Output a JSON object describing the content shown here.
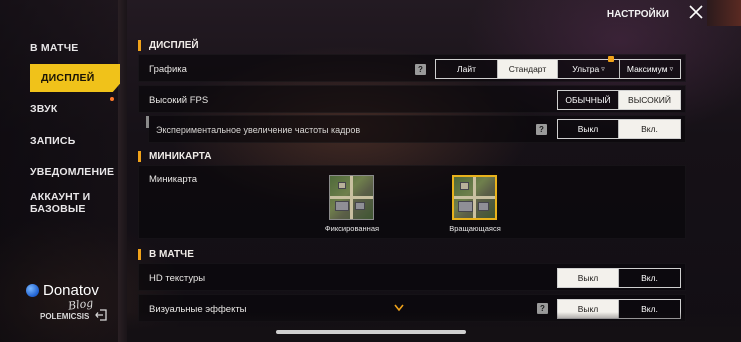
{
  "header": {
    "title": "НАСТРОЙКИ"
  },
  "sidebar": {
    "items": [
      {
        "label": "В МАТЧЕ"
      },
      {
        "label": "ДИСПЛЕЙ"
      },
      {
        "label": "ЗВУК"
      },
      {
        "label": "ЗАПИСЬ"
      },
      {
        "label": "УВЕДОМЛЕНИЕ"
      },
      {
        "label": "АККАУНТ И\nБАЗОВЫЕ"
      }
    ],
    "active_index": 1
  },
  "display": {
    "section_title": "ДИСПЛЕЙ",
    "graphics": {
      "label": "Графика",
      "help": "?",
      "options": [
        "Лайт",
        "Стандарт",
        "Ультра",
        "Максимум"
      ],
      "selected": "Стандарт"
    },
    "high_fps": {
      "label": "Высокий FPS",
      "options": [
        "ОБЫЧНЫЙ",
        "ВЫСОКИЙ"
      ],
      "selected": "ВЫСОКИЙ"
    },
    "experimental_fps": {
      "label": "Экспериментальное увеличение частоты кадров",
      "help": "?",
      "options": [
        "Выкл",
        "Вкл."
      ],
      "selected": "Вкл."
    }
  },
  "minimap": {
    "section_title": "МИНИКАРТА",
    "label": "Миникарта",
    "options": [
      "Фиксированная",
      "Вращающаяся"
    ],
    "selected": "Вращающаяся"
  },
  "in_match": {
    "section_title": "В МАТЧЕ",
    "hd_textures": {
      "label": "HD текстуры",
      "options": [
        "Выкл",
        "Вкл."
      ],
      "selected": "Выкл"
    },
    "visual_effects": {
      "label": "Визуальные эффекты",
      "help": "?",
      "options": [
        "Выкл",
        "Вкл."
      ],
      "selected": "Выкл"
    }
  },
  "watermark": {
    "name": "Donatov",
    "sub": "Blog"
  },
  "user": {
    "name": "POLEMICSIS"
  },
  "colors": {
    "accent": "#f0c21a",
    "section_bar": "#f0a21a",
    "selected_segment": "#f3f1ec"
  }
}
